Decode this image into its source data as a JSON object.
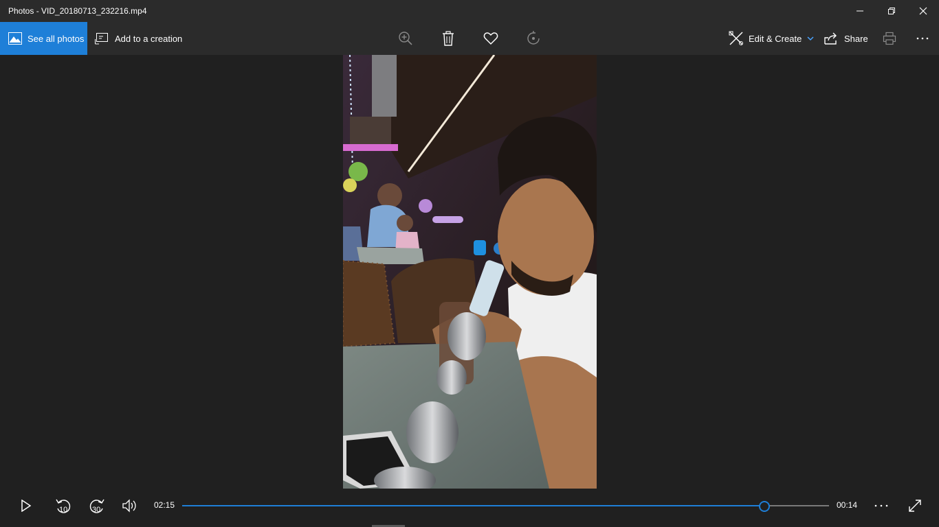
{
  "window": {
    "title": "Photos - VID_20180713_232216.mp4"
  },
  "toolbar": {
    "see_all_label": "See all photos",
    "add_creation_label": "Add to a creation",
    "edit_create_label": "Edit & Create",
    "share_label": "Share"
  },
  "player": {
    "elapsed": "02:15",
    "remaining": "00:14",
    "progress_fraction": 0.9,
    "rewind_seconds": "10",
    "forward_seconds": "30"
  },
  "colors": {
    "accent": "#1e7fd8",
    "chrome": "#2b2b2b",
    "background": "#202020"
  }
}
